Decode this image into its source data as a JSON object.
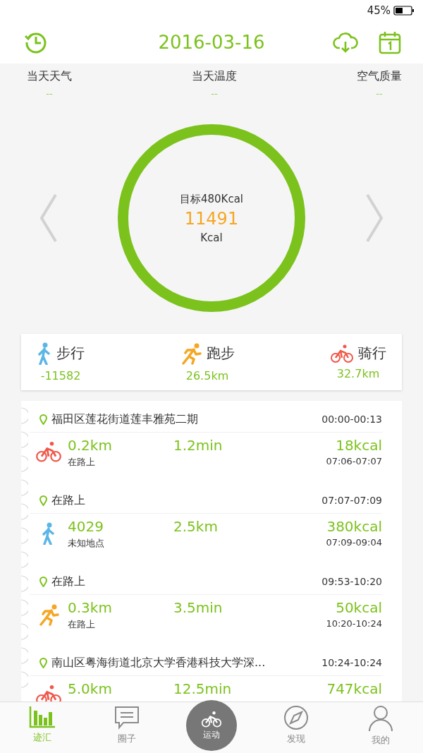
{
  "status_bar": {
    "battery": "45%"
  },
  "header": {
    "date": "2016-03-16"
  },
  "weather": [
    {
      "label": "当天天气",
      "value": "--"
    },
    {
      "label": "当天温度",
      "value": "--"
    },
    {
      "label": "空气质量",
      "value": "--"
    }
  ],
  "ring": {
    "goal": "目标480Kcal",
    "value": "11491",
    "unit": "Kcal"
  },
  "summary": [
    {
      "kind": "walk",
      "label": "步行",
      "value": "-11582"
    },
    {
      "kind": "run",
      "label": "跑步",
      "value": "26.5km"
    },
    {
      "kind": "bike",
      "label": "骑行",
      "value": "32.7km"
    }
  ],
  "records": [
    {
      "location": "福田区莲花街道莲丰雅苑二期",
      "location_time": "00:00-00:13",
      "kind": "bike",
      "value1": "0.2km",
      "place": "在路上",
      "value2": "1.2min",
      "value3": "18kcal",
      "time": "07:06-07:07"
    },
    {
      "location": "在路上",
      "location_time": "07:07-07:09",
      "kind": "walk",
      "value1": "4029",
      "place": "未知地点",
      "value2": "2.5km",
      "value3": "380kcal",
      "time": "07:09-09:04"
    },
    {
      "location": "在路上",
      "location_time": "09:53-10:20",
      "kind": "run",
      "value1": "0.3km",
      "place": "在路上",
      "value2": "3.5min",
      "value3": "50kcal",
      "time": "10:20-10:24"
    },
    {
      "location": "南山区粤海街道北京大学香港科技大学深...",
      "location_time": "10:24-10:24",
      "kind": "bike",
      "value1": "5.0km",
      "value2": "12.5min",
      "value3": "747kcal"
    }
  ],
  "tabs": [
    {
      "kind": "chart",
      "label": "迹汇",
      "selected": true
    },
    {
      "kind": "chat",
      "label": "圈子",
      "selected": false
    },
    {
      "kind": "sport",
      "label": "运动",
      "selected": false
    },
    {
      "kind": "compass",
      "label": "发现",
      "selected": false
    },
    {
      "kind": "person",
      "label": "我的",
      "selected": false
    }
  ]
}
